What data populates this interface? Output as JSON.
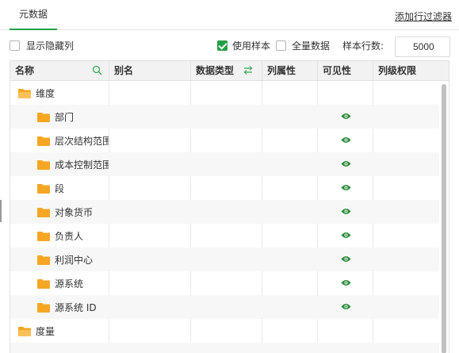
{
  "tabs": {
    "active_label": "元数据"
  },
  "header": {
    "filter_link": "添加行过滤器"
  },
  "options": {
    "show_hidden": {
      "label": "显示隐藏列",
      "checked": false
    },
    "use_sample": {
      "label": "使用样本",
      "checked": true
    },
    "full_data": {
      "label": "全量数据",
      "checked": false
    },
    "sample_rows_label": "样本行数:",
    "sample_rows_value": "5000"
  },
  "table": {
    "columns": [
      "名称",
      "别名",
      "数据类型",
      "列属性",
      "可见性",
      "列级权限"
    ],
    "rows": [
      {
        "name": "维度",
        "level": 0,
        "visible": false
      },
      {
        "name": "部门",
        "level": 1,
        "visible": true
      },
      {
        "name": "层次结构范围",
        "level": 1,
        "visible": true
      },
      {
        "name": "成本控制范围",
        "level": 1,
        "visible": true
      },
      {
        "name": "段",
        "level": 1,
        "visible": true
      },
      {
        "name": "对象货币",
        "level": 1,
        "visible": true
      },
      {
        "name": "负责人",
        "level": 1,
        "visible": true
      },
      {
        "name": "利润中心",
        "level": 1,
        "visible": true
      },
      {
        "name": "源系统",
        "level": 1,
        "visible": true
      },
      {
        "name": "源系统 ID",
        "level": 1,
        "visible": true
      },
      {
        "name": "度量",
        "level": 0,
        "visible": false
      }
    ]
  },
  "colors": {
    "accent": "#22a046",
    "folder": "#f5a623",
    "eye": "#2e8b3e"
  }
}
